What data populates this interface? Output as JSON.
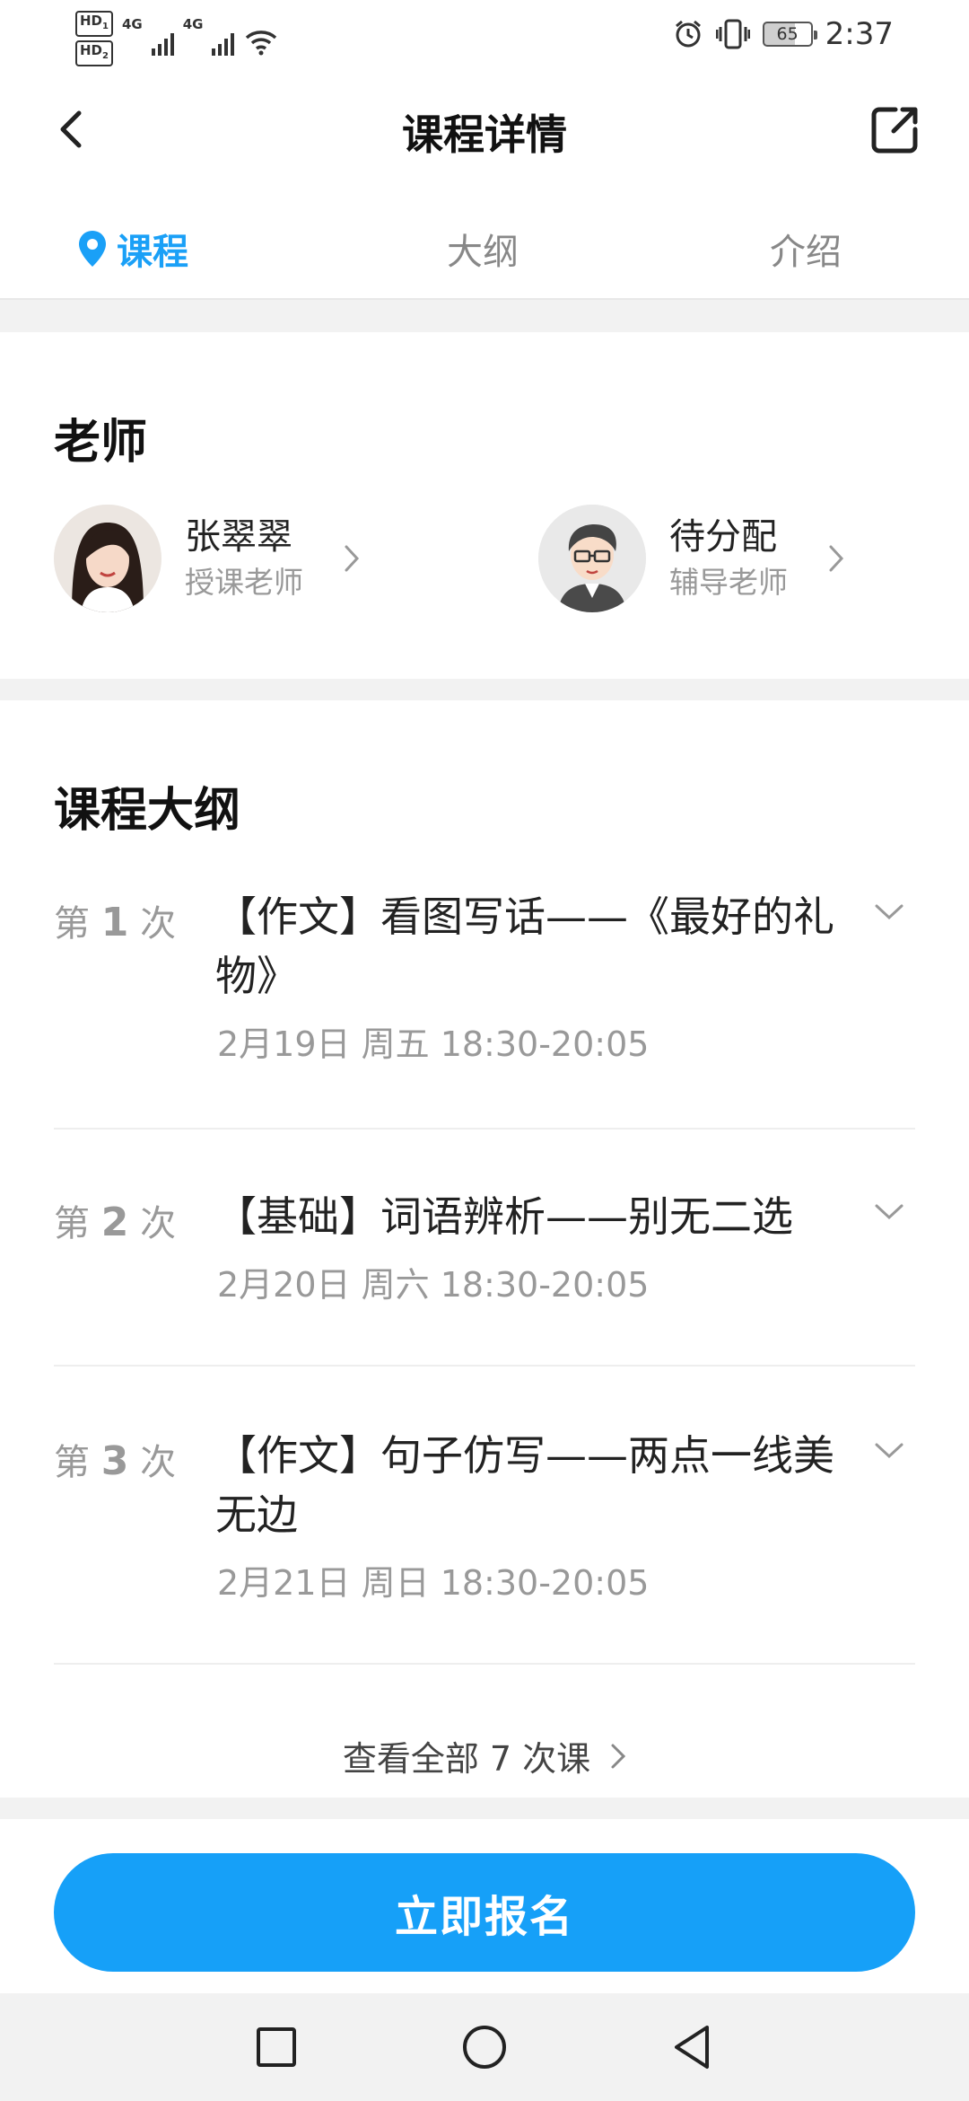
{
  "status_bar": {
    "hd1": "HD",
    "hd1_sub": "1",
    "hd2": "HD",
    "hd2_sub": "2",
    "net1": "4G",
    "net2": "4G",
    "battery": "65",
    "time": "2:37",
    "battery_level": 0.65,
    "icons": [
      "alarm-icon",
      "vibrate-icon",
      "wifi-icon",
      "signal-icon"
    ]
  },
  "header": {
    "title": "课程详情"
  },
  "tabs": [
    {
      "label": "课程",
      "active": true
    },
    {
      "label": "大纲",
      "active": false
    },
    {
      "label": "介绍",
      "active": false
    }
  ],
  "teachers": {
    "section_title": "老师",
    "items": [
      {
        "name": "张翠翠",
        "role": "授课老师"
      },
      {
        "name": "待分配",
        "role": "辅导老师"
      }
    ]
  },
  "outline": {
    "section_title": "课程大纲",
    "prefix": "第",
    "suffix": "次",
    "lessons": [
      {
        "index": "1",
        "title": "【作文】看图写话——《最好的礼物》",
        "time": "2月19日 周五 18:30-20:05"
      },
      {
        "index": "2",
        "title": "【基础】词语辨析——别无二选",
        "time": "2月20日 周六 18:30-20:05"
      },
      {
        "index": "3",
        "title": "【作文】句子仿写——两点一线美无边",
        "time": "2月21日 周日 18:30-20:05"
      }
    ],
    "view_all": "查看全部 7 次课"
  },
  "bottom": {
    "enroll_label": "立即报名"
  },
  "colors": {
    "accent": "#16a0f8",
    "text_primary": "#222222",
    "text_secondary": "#999999",
    "background": "#f2f2f2"
  }
}
